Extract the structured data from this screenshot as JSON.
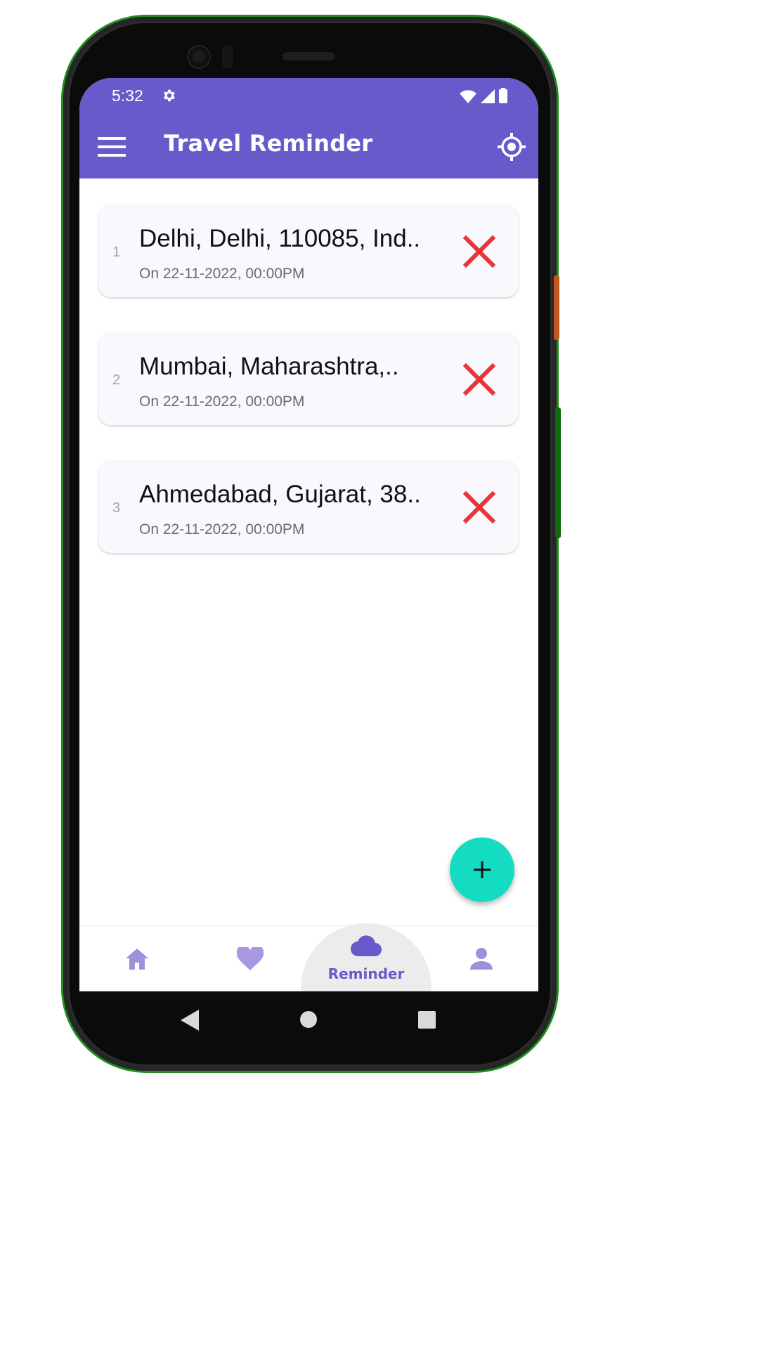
{
  "status_bar": {
    "time": "5:32"
  },
  "app_bar": {
    "title": "Travel Reminder",
    "menu_icon": "hamburger-menu-icon",
    "action_icon": "my-location-icon"
  },
  "reminders": [
    {
      "index": "1",
      "place": "Delhi, Delhi, 110085, Ind..",
      "date": "On 22-11-2022, 00:00PM"
    },
    {
      "index": "2",
      "place": "Mumbai, Maharashtra,..",
      "date": "On 22-11-2022, 00:00PM"
    },
    {
      "index": "3",
      "place": "Ahmedabad, Gujarat, 38..",
      "date": "On 22-11-2022, 00:00PM"
    }
  ],
  "fab": {
    "icon": "plus-icon"
  },
  "bottom_nav": {
    "active_label": "Reminder",
    "items": [
      "home-icon",
      "heart-icon",
      "cloud-icon",
      "person-icon"
    ]
  },
  "colors": {
    "primary": "#675acb",
    "accent": "#14dcc3",
    "delete": "#e8353a"
  }
}
